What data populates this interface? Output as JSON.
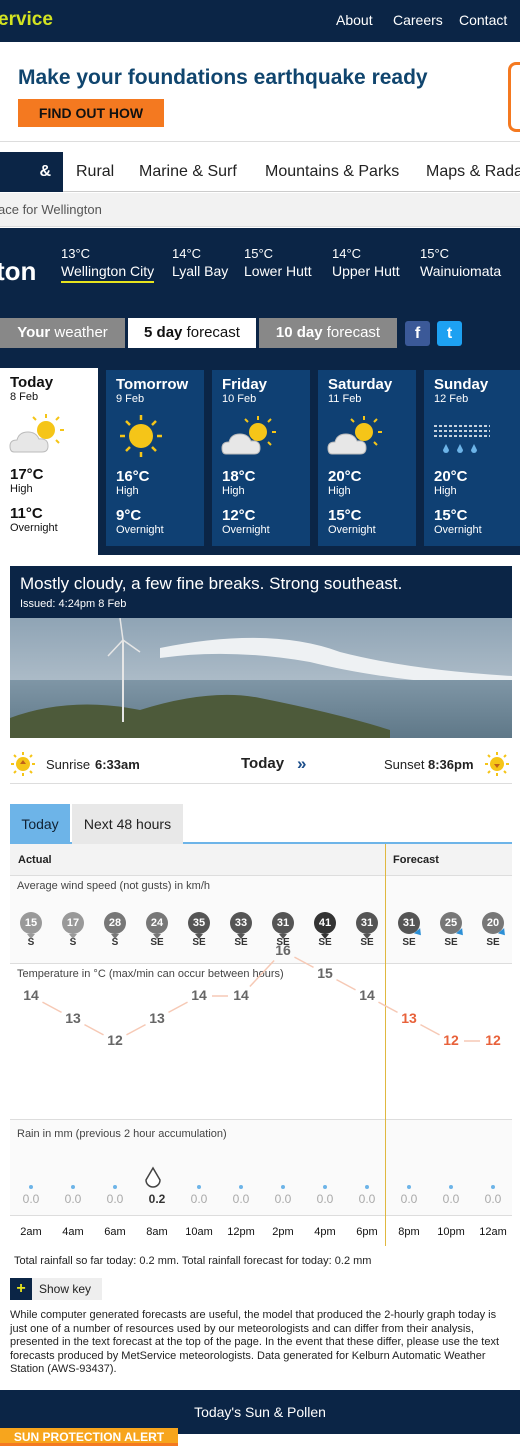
{
  "header": {
    "brand": "ervice",
    "links": [
      "About",
      "Careers",
      "Contact"
    ]
  },
  "ad": {
    "title": "Make your foundations earthquake ready",
    "button": "FIND OUT HOW"
  },
  "nav": {
    "tabs": [
      "& Cities",
      "Rural",
      "Marine & Surf",
      "Mountains & Parks",
      "Maps & Rada"
    ]
  },
  "breadcrumb": "ace for Wellington",
  "location": {
    "name": "ton",
    "locations": [
      {
        "temp": "13°C",
        "name": "Wellington City"
      },
      {
        "temp": "14°C",
        "name": "Lyall Bay"
      },
      {
        "temp": "15°C",
        "name": "Lower Hutt"
      },
      {
        "temp": "14°C",
        "name": "Upper Hutt"
      },
      {
        "temp": "15°C",
        "name": "Wainuiomata"
      }
    ]
  },
  "view_tabs": [
    {
      "bold": "Your",
      "rest": " weather"
    },
    {
      "bold": "5 day",
      "rest": " forecast"
    },
    {
      "bold": "10 day",
      "rest": " forecast"
    }
  ],
  "social": {
    "facebook": "f",
    "twitter": "t"
  },
  "days": [
    {
      "name": "Today",
      "date": "8 Feb",
      "icon": "partly-cloudy-icon",
      "high": "17°C",
      "high_label": "High",
      "low": "11°C",
      "low_label": "Overnight"
    },
    {
      "name": "Tomorrow",
      "date": "9 Feb",
      "icon": "sunny-icon",
      "high": "16°C",
      "high_label": "High",
      "low": "9°C",
      "low_label": "Overnight"
    },
    {
      "name": "Friday",
      "date": "10 Feb",
      "icon": "partly-cloudy-icon",
      "high": "18°C",
      "high_label": "High",
      "low": "12°C",
      "low_label": "Overnight"
    },
    {
      "name": "Saturday",
      "date": "11 Feb",
      "icon": "partly-cloudy-icon",
      "high": "20°C",
      "high_label": "High",
      "low": "15°C",
      "low_label": "Overnight"
    },
    {
      "name": "Sunday",
      "date": "12 Feb",
      "icon": "windy-rain-icon",
      "high": "20°C",
      "high_label": "High",
      "low": "15°C",
      "low_label": "Overnight"
    }
  ],
  "summary": {
    "title": "Mostly cloudy, a few fine breaks. Strong southeast.",
    "issued": "Issued: 4:24pm 8 Feb"
  },
  "sun": {
    "sunrise_label": "Sunrise",
    "sunrise": "6:33am",
    "center": "Today",
    "sunset_label": "Sunset",
    "sunset": "8:36pm"
  },
  "graph_tabs": [
    "Today",
    "Next 48 hours"
  ],
  "graph": {
    "actual_label": "Actual",
    "forecast_label": "Forecast",
    "wind_title": "Average wind speed (not gusts) in km/h",
    "temp_title": "Temperature in °C (max/min can occur between hours)",
    "rain_title": "Rain in mm (previous 2 hour accumulation)",
    "times": [
      "2am",
      "4am",
      "6am",
      "8am",
      "10am",
      "12pm",
      "2pm",
      "4pm",
      "6pm",
      "8pm",
      "10pm",
      "12am"
    ],
    "wind_speed": [
      "15",
      "17",
      "28",
      "24",
      "35",
      "33",
      "31",
      "41",
      "31",
      "31",
      "25",
      "20"
    ],
    "wind_dir": [
      "S",
      "S",
      "S",
      "SE",
      "SE",
      "SE",
      "SE",
      "SE",
      "SE",
      "SE",
      "SE",
      "SE"
    ],
    "temps": [
      14,
      13,
      12,
      13,
      14,
      14,
      16,
      15,
      14,
      13,
      12,
      12
    ],
    "rain": [
      "0.0",
      "0.0",
      "0.0",
      "0.2",
      "0.0",
      "0.0",
      "0.0",
      "0.0",
      "0.0",
      "0.0",
      "0.0",
      "0.0"
    ],
    "forecast_start_index": 9
  },
  "rain_total": "Total rainfall so far today: 0.2 mm. Total rainfall forecast for today: 0.2 mm",
  "show_key": "Show key",
  "disclaimer": "While computer generated forecasts are useful, the model that produced the 2-hourly graph today is just one of a number of resources used by our meteorologists and can differ from their analysis, presented in the text forecast at the top of the page. In the event that these differ, please use the text forecasts produced by MetService meteorologists. Data generated for Kelburn Automatic Weather Station (AWS-93437).",
  "sun_pollen": "Today's Sun & Pollen",
  "alert": "SUN PROTECTION ALERT",
  "colors": {
    "navy": "#0b2546",
    "accent": "#e6e31e",
    "orange": "#f47920",
    "forecast_temp": "#e8613a"
  }
}
